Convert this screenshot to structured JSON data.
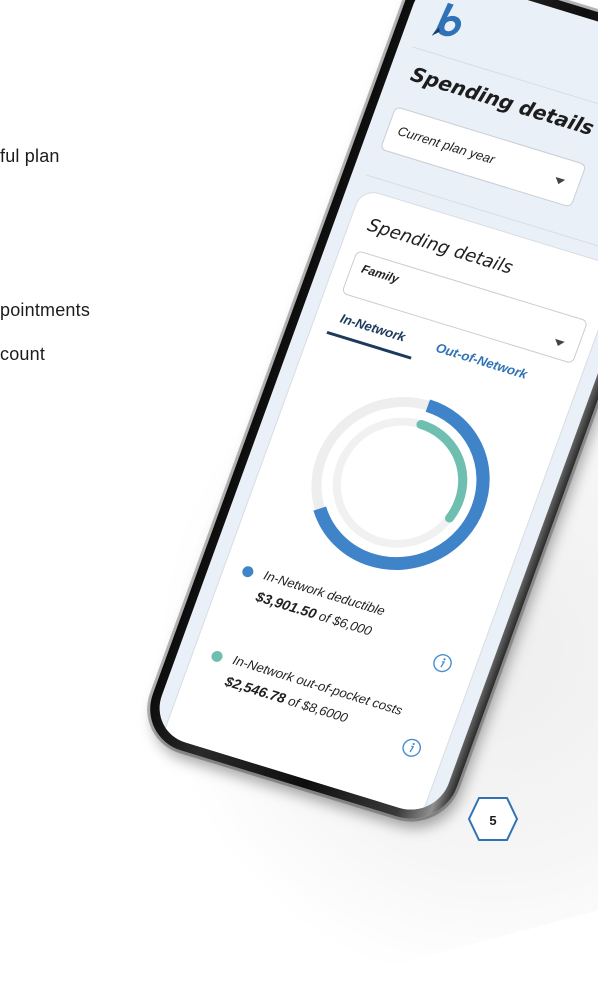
{
  "background_text": {
    "line1": "ful plan",
    "line2": "pointments",
    "line3": "count"
  },
  "app": {
    "logo_letter": "b",
    "page_title": "Spending details",
    "plan_period_select": {
      "selected": "Current plan year"
    }
  },
  "card": {
    "title": "Spending details",
    "coverage_select": {
      "selected": "Family"
    },
    "tabs": [
      {
        "label": "In-Network",
        "active": true
      },
      {
        "label": "Out-of-Network",
        "active": false
      }
    ],
    "ring": {
      "deductible_fraction": 0.65,
      "oop_fraction": 0.3,
      "deductible_color": "#3f83c9",
      "oop_color": "#6fbfb0",
      "track_color": "#eeeeee"
    },
    "legend": [
      {
        "label": "In-Network deductible",
        "amount": "$3,901.50",
        "of_text": "of $6,000",
        "color": "#3f83c9",
        "icon": "info-icon"
      },
      {
        "label": "In-Network out-of-pocket costs",
        "amount": "$2,546.78",
        "of_text": "of $8,6000",
        "color": "#6fbfb0",
        "icon": "info-icon"
      }
    ]
  },
  "page_number": "5",
  "colors": {
    "accent_dark": "#1b3a5c",
    "accent": "#2f73b6",
    "screen_bg": "#e9f0f7"
  }
}
